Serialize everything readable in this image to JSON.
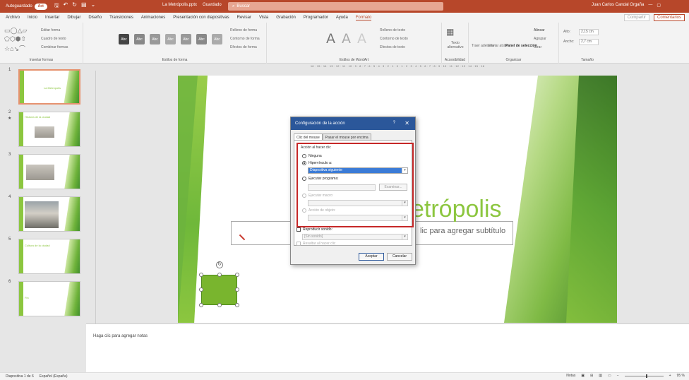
{
  "titlebar": {
    "autosave_label": "Autoguardado",
    "autosave_state": "Act",
    "doc_name": "La Metrópolis.pptx",
    "doc_status": "Guardado",
    "search_placeholder": "Buscar",
    "user_name": "Juan Carlos Candal Orgaña"
  },
  "tabs": [
    "Archivo",
    "Inicio",
    "Insertar",
    "Dibujar",
    "Diseño",
    "Transiciones",
    "Animaciones",
    "Presentación con diapositivas",
    "Revisar",
    "Vista",
    "Grabación",
    "Programador",
    "Ayuda",
    "Formato"
  ],
  "active_tab": "Formato",
  "share_label": "Compartir",
  "comments_label": "Comentarios",
  "ribbon": {
    "insert_shapes_label": "Insertar formas",
    "edit_shape": "Editar forma",
    "text_box": "Cuadro de texto",
    "combine_shapes": "Combinar formas",
    "shape_styles_label": "Estilos de forma",
    "shape_fill": "Relleno de forma",
    "shape_outline": "Contorno de forma",
    "shape_effects": "Efectos de forma",
    "style_sample": "Abc",
    "wordart_label": "Estilos de WordArt",
    "text_fill": "Relleno de texto",
    "text_outline": "Contorno de texto",
    "text_effects": "Efectos de texto",
    "alt_text": "Texto alternativo",
    "accessibility_label": "Accesibilidad",
    "bring_forward": "Traer adelante",
    "send_backward": "Enviar atrás",
    "selection_pane": "Panel de selección",
    "align": "Alinear",
    "group": "Agrupar",
    "rotate": "Girar",
    "organize_label": "Organizar",
    "height_label": "Alto:",
    "height_value": "2,15 cm",
    "width_label": "Ancho:",
    "width_value": "2,7 cm",
    "size_label": "Tamaño"
  },
  "ruler_text": "16 · 15 · 14 · 13 · 12 · 11 · 10 · 9 · 8 · 7 · 6 · 5 · 4 · 3 · 2 · 1 · 0 · 1 · 2 · 3 · 4 · 5 · 6 · 7 · 8 · 9 · 10 · 11 · 12 · 13 · 14 · 15 · 16",
  "thumbnails": [
    {
      "num": "1",
      "title": "La Metrópolis"
    },
    {
      "num": "2",
      "title": "Historia de la ciudad"
    },
    {
      "num": "3",
      "title": ""
    },
    {
      "num": "4",
      "title": ""
    },
    {
      "num": "5",
      "title": "Cultura de la ciudad"
    },
    {
      "num": "6",
      "title": "Fin"
    }
  ],
  "slide": {
    "title": "etrópolis",
    "subtitle_placeholder": "lic para agregar subtítulo"
  },
  "dialog": {
    "title": "Configuración de la acción",
    "help": "?",
    "close": "✕",
    "tab_click": "Clic del mouse",
    "tab_hover": "Pasar el mouse por encima",
    "group_label": "Acción al hacer clic",
    "opt_none": "Ninguna",
    "opt_hyperlink": "Hipervínculo a:",
    "hyperlink_value": "Diapositiva siguiente",
    "opt_run_program": "Ejecutar programa:",
    "browse": "Examinar...",
    "opt_run_macro": "Ejecutar macro:",
    "opt_object_action": "Acción de objeto:",
    "play_sound": "Reproducir sonido:",
    "sound_value": "[Sin sonido]",
    "highlight_click": "Resaltar al hacer clic",
    "ok": "Aceptar",
    "cancel": "Cancelar"
  },
  "notes_placeholder": "Haga clic para agregar notas",
  "status": {
    "slide_info": "Diapositiva 1 de 6",
    "language": "Español (España)",
    "notes": "Notas",
    "zoom": "95 %"
  },
  "colors": {
    "titlebar": "#b7472a",
    "accent_green": "#8cc63f",
    "dialog_title": "#2b579a",
    "highlight_red": "#c62828"
  }
}
